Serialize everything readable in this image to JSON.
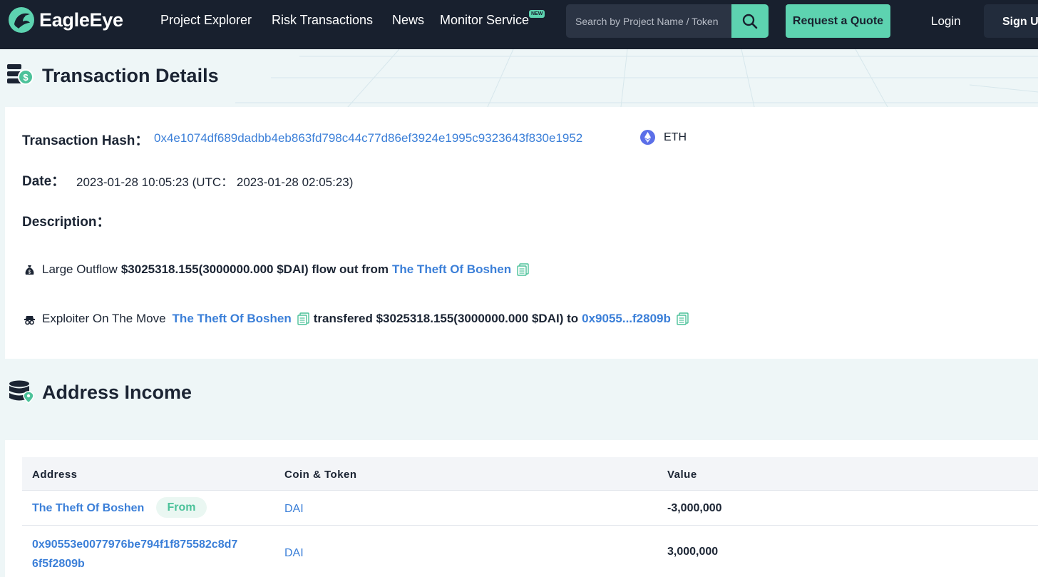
{
  "nav": {
    "brand": "EagleEye",
    "links": [
      "Project Explorer",
      "Risk Transactions",
      "News",
      "Monitor Service"
    ],
    "new_badge": "NEW",
    "search_placeholder": "Search by Project Name / Token",
    "quote_button": "Request a Quote",
    "login": "Login",
    "signup": "Sign Up",
    "accent_color": "#5dd3b0",
    "bg_color": "#18202e"
  },
  "details": {
    "title": "Transaction Details",
    "hash_label": "Transaction Hash：",
    "hash_value": "0x4e1074df689dadbb4eb863fd798c44c77d86ef3924e1995c9323643f830e1952",
    "chain": "ETH",
    "date_label": "Date：",
    "date_value": "2023-01-28 10:05:23 (UTC：  2023-01-28 02:05:23)",
    "description_label": "Description：",
    "item1": {
      "prefix": "Large Outflow",
      "amount": "$3025318.155(3000000.000 $DAI) flow out from",
      "entity": "The Theft Of Boshen"
    },
    "item2": {
      "prefix": "Exploiter On The Move",
      "entity": "The Theft Of Boshen",
      "middle": "transfered $3025318.155(3000000.000 $DAI) to",
      "target": "0x9055...f2809b"
    }
  },
  "income": {
    "title": "Address Income",
    "columns": [
      "Address",
      "Coin & Token",
      "Value"
    ],
    "rows": [
      {
        "address": "The Theft Of Boshen",
        "badge": "From",
        "token": "DAI",
        "value": "-3,000,000"
      },
      {
        "address_line1": "0x90553e0077976be794f1f875582c8d7",
        "address_line2": "6f5f2809b",
        "token": "DAI",
        "value": "3,000,000"
      }
    ]
  }
}
